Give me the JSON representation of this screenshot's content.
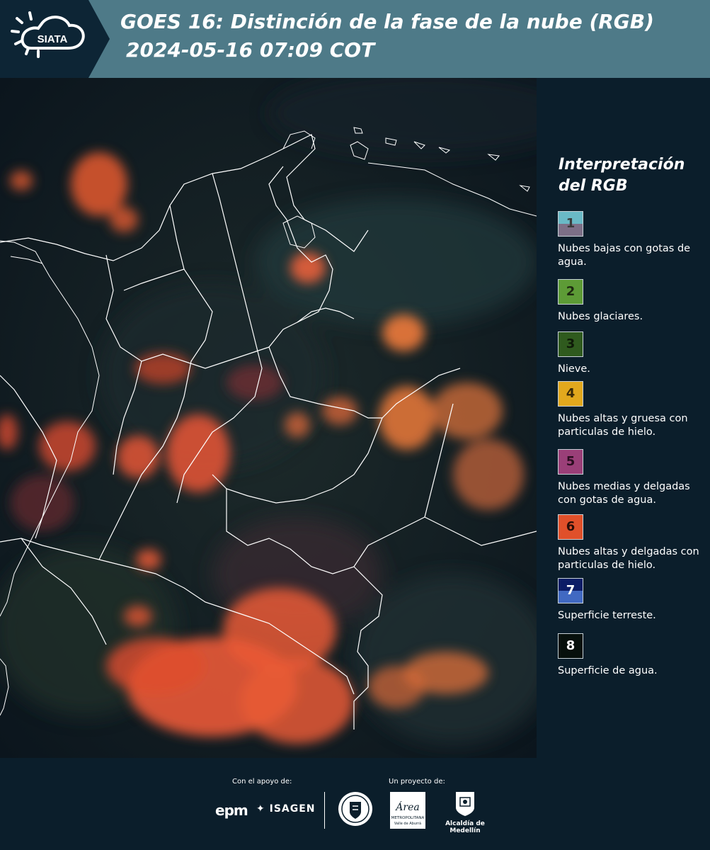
{
  "header": {
    "title_line1": "GOES 16: Distinción de la fase de la nube (RGB)",
    "title_line2": "2024-05-16 07:09 COT",
    "logo_text": "SIATA"
  },
  "legend": {
    "title": "Interpretación del RGB",
    "items": [
      {
        "number": "1",
        "label": "Nubes bajas con gotas de agua.",
        "color_top": "#6ab9c6",
        "color_bottom": "#7d6f87",
        "num_color": "#3a3a3a"
      },
      {
        "number": "2",
        "label": "Nubes glaciares.",
        "color_top": "#5d9b36",
        "color_bottom": "#5d9b36",
        "num_color": "#1e2a10"
      },
      {
        "number": "3",
        "label": "Nieve.",
        "color_top": "#2f5a1e",
        "color_bottom": "#2f5a1e",
        "num_color": "#0e1a08"
      },
      {
        "number": "4",
        "label": "Nubes altas y gruesa con particulas de hielo.",
        "color_top": "#e2a81d",
        "color_bottom": "#e2a81d",
        "num_color": "#3a2a08"
      },
      {
        "number": "5",
        "label": "Nubes medias y delgadas con gotas de agua.",
        "color_top": "#9a3f78",
        "color_bottom": "#9a3f78",
        "num_color": "#2a0e20"
      },
      {
        "number": "6",
        "label": "Nubes altas y delgadas con particulas de hielo.",
        "color_top": "#e0502a",
        "color_bottom": "#e0502a",
        "num_color": "#2a0e08"
      },
      {
        "number": "7",
        "label": "Superficie terreste.",
        "color_top": "#0c1c66",
        "color_bottom": "#4169c2",
        "num_color": "#ffffff"
      },
      {
        "number": "8",
        "label": "Superficie de agua.",
        "color_top": "#07100c",
        "color_bottom": "#07100c",
        "num_color": "#ffffff"
      }
    ]
  },
  "footer": {
    "support_label": "Con el apoyo de:",
    "project_label": "Un proyecto de:",
    "epm": "epm",
    "isagen": "ISAGEN",
    "amva_script": "Área",
    "amva_name": "METROPOLITANA",
    "amva_sub": "Valle de Aburrá",
    "medellin": "Alcaldía de Medellín"
  },
  "colors": {
    "header_bg": "#4e7a88",
    "panel_bg": "#0b1e2b",
    "cloud_high_thin": "#e0502a",
    "cloud_high_thick": "#e2a81d",
    "border_lines": "#ffffff"
  }
}
